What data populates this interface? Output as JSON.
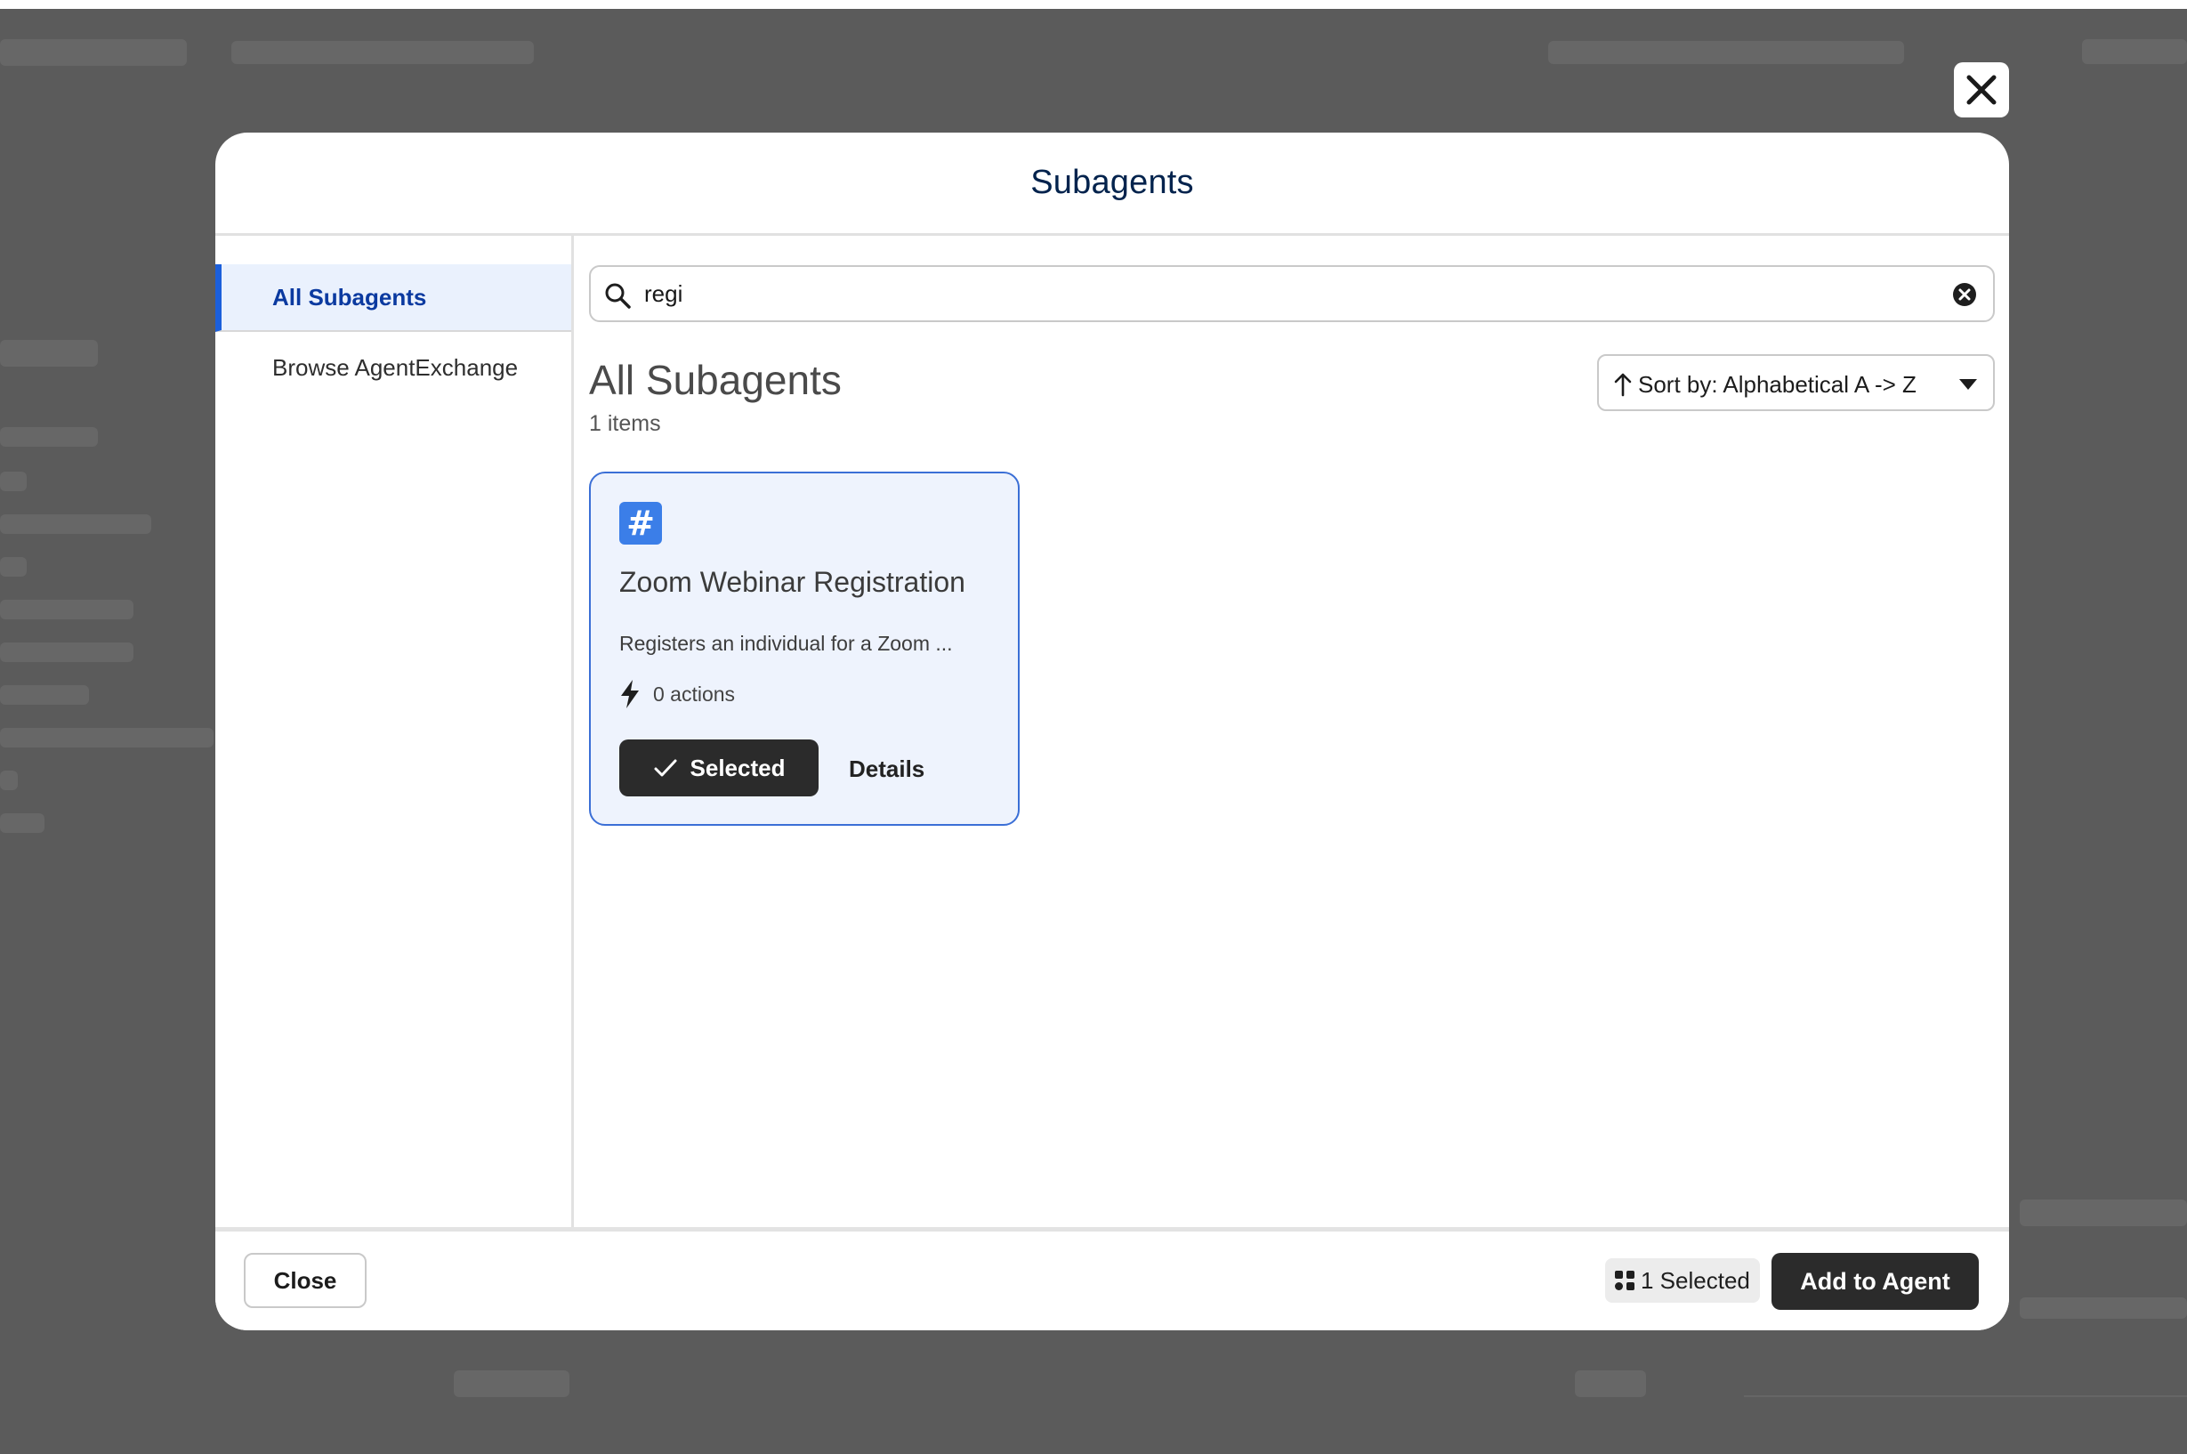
{
  "modal": {
    "title": "Subagents"
  },
  "sidebar": {
    "items": [
      {
        "label": "All Subagents",
        "active": true
      },
      {
        "label": "Browse AgentExchange",
        "active": false
      }
    ]
  },
  "search": {
    "value": "regi",
    "icon": "search-icon",
    "clear_icon": "clear-icon"
  },
  "main": {
    "section_title": "All Subagents",
    "item_count": "1 items",
    "sort": {
      "label": "Sort by: Alphabetical A -> Z",
      "direction_icon": "arrow-up-icon",
      "caret_icon": "caret-down-icon"
    },
    "cards": [
      {
        "icon": "hash-icon",
        "icon_glyph": "#",
        "title": "Zoom Webinar Registration",
        "description": "Registers an individual for a Zoom ...",
        "actions_text": "0 actions",
        "selected_label": "Selected",
        "details_label": "Details"
      }
    ]
  },
  "footer": {
    "close_label": "Close",
    "selected_count": "1 Selected",
    "add_label": "Add to Agent"
  },
  "colors": {
    "accent": "#1b5fdb",
    "card_bg": "#eef3fd",
    "card_border": "#3b6fd6",
    "dark_button": "#2b2b2b",
    "icon_blue": "#3b7ee8",
    "overlay": "#5b5b5b"
  }
}
